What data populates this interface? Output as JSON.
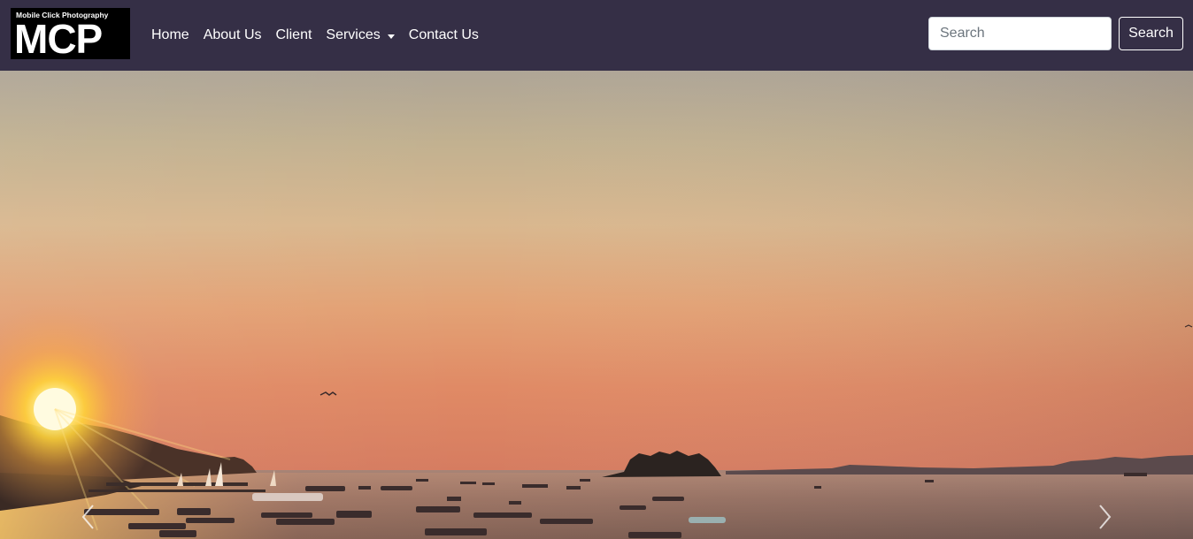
{
  "brand": {
    "subtitle": "Mobile Click Photography",
    "logo_text": "MCP"
  },
  "nav": {
    "items": [
      {
        "label": "Home"
      },
      {
        "label": "About Us"
      },
      {
        "label": "Client"
      },
      {
        "label": "Services",
        "dropdown": true
      },
      {
        "label": "Contact Us"
      }
    ]
  },
  "search": {
    "placeholder": "Search",
    "value": "",
    "button_label": "Search"
  },
  "carousel": {
    "slide_description": "sunset-over-lake-with-boats",
    "prev_icon": "chevron-left-icon",
    "next_icon": "chevron-right-icon"
  },
  "colors": {
    "navbar_bg": "#352f46",
    "sky_top": "#b4a89a",
    "sky_mid": "#ddb88c",
    "sky_low": "#e49567",
    "water": "#8a6a5e"
  }
}
